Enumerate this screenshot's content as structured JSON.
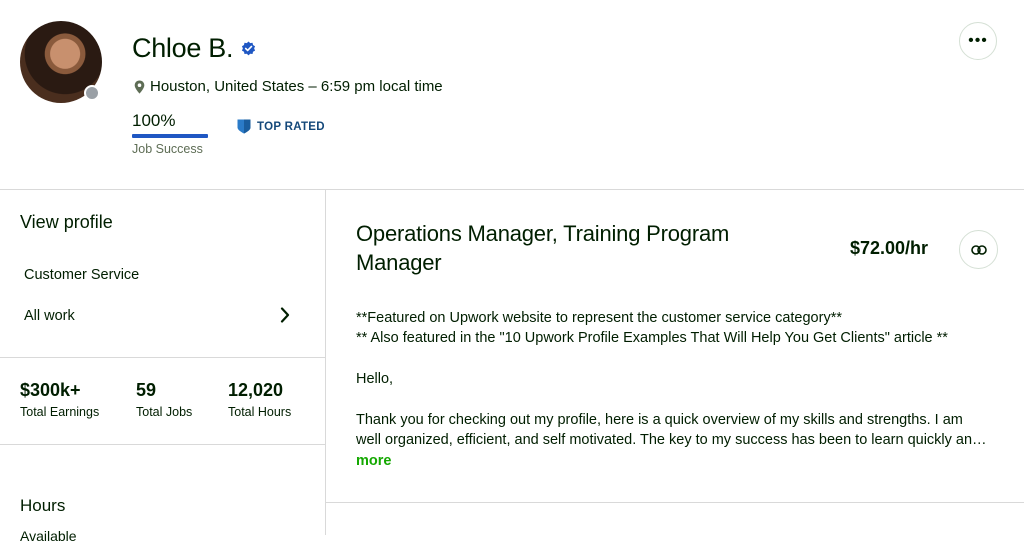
{
  "profile": {
    "name": "Chloe B.",
    "location": "Houston, United States – 6:59 pm local time",
    "job_success_pct": "100%",
    "job_success_value": 1.0,
    "job_success_label": "Job Success",
    "badge": "TOP RATED",
    "more_icon": "ellipsis-icon",
    "online_status": "offline"
  },
  "sidebar": {
    "title": "View profile",
    "items": [
      {
        "label": "Customer Service"
      },
      {
        "label": "All work"
      }
    ],
    "stats": [
      {
        "value": "$300k+",
        "label": "Total Earnings"
      },
      {
        "value": "59",
        "label": "Total Jobs"
      },
      {
        "value": "12,020",
        "label": "Total Hours"
      }
    ],
    "hours_title": "Hours",
    "availability_partial": "Available"
  },
  "main": {
    "title": "Operations Manager, Training Program Manager",
    "rate": "$72.00/hr",
    "description": [
      "**Featured on Upwork website to represent the customer service category**",
      "** Also featured in the \"10 Upwork Profile Examples That Will Help You Get Clients\" article **",
      "Hello,",
      "Thank you for checking out my profile, here is a quick overview of my skills and strengths. I am",
      "well organized, efficient, and self motivated. The key to my success has been to learn quickly an…"
    ],
    "more_label": "more"
  },
  "colors": {
    "accent_green": "#14a800",
    "job_success_bar": "#1f57c3",
    "top_rated": "#14487a",
    "verified": "#1f57c3"
  }
}
